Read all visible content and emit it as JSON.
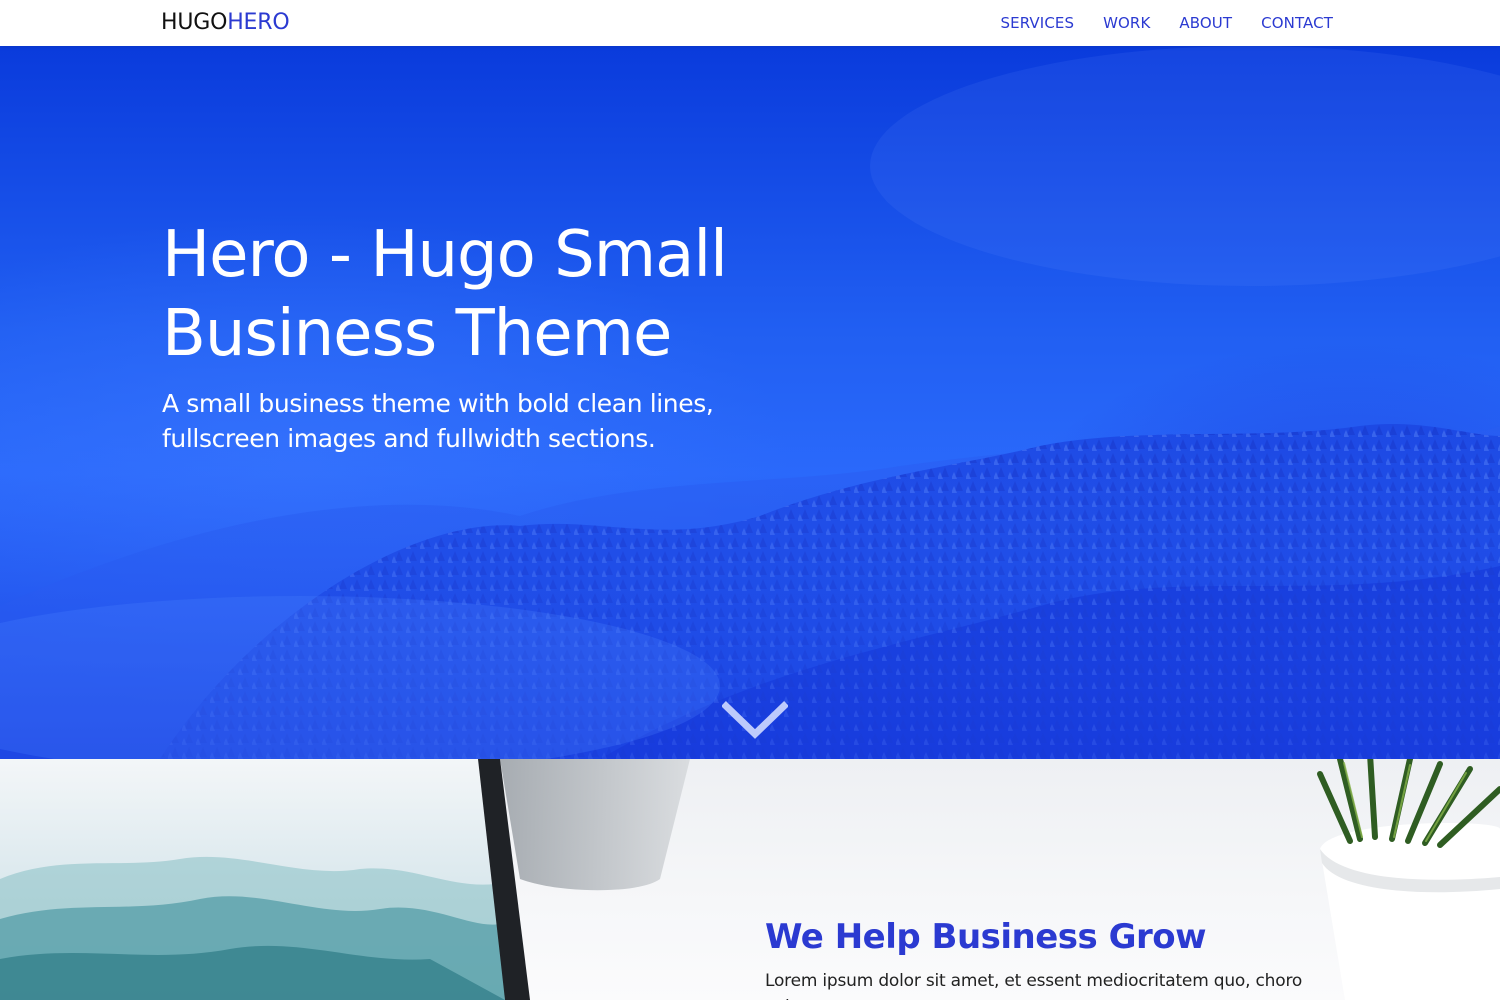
{
  "header": {
    "brand_part1": "HUGO",
    "brand_part2": "HERO",
    "nav": [
      {
        "label": "SERVICES"
      },
      {
        "label": "WORK"
      },
      {
        "label": "ABOUT"
      },
      {
        "label": "CONTACT"
      }
    ]
  },
  "hero": {
    "title": "Hero - Hugo Small Business Theme",
    "subtitle": "A small business theme with bold clean lines, fullscreen images and fullwidth sections.",
    "scroll_icon": "chevron-down-icon"
  },
  "services": {
    "title": "We Help Business Grow",
    "text": "Lorem ipsum dolor sit amet, et essent mediocritatem quo, choro volumus"
  },
  "colors": {
    "accent": "#2b3ad1",
    "hero_blue": "#215ff2",
    "text_dark": "#111111"
  }
}
